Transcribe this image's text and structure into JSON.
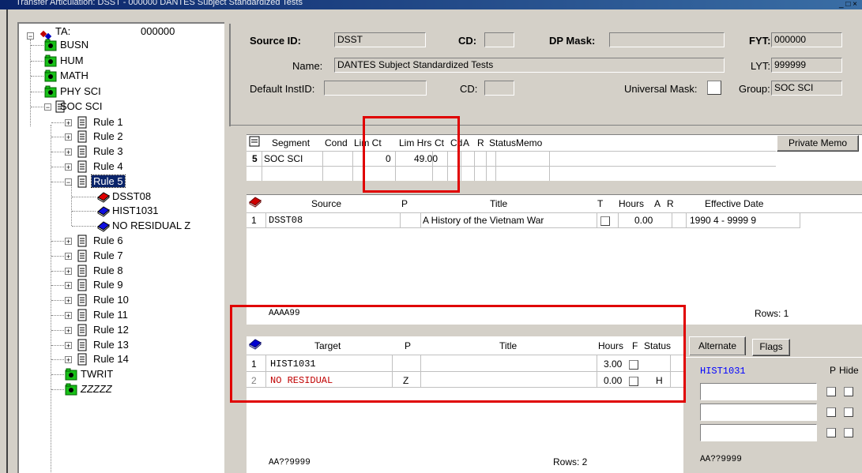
{
  "window": {
    "title": "Transfer Articulation: DSST - 000000 DANTES Subject Standardized Tests"
  },
  "tree": {
    "root": {
      "label": "TA:",
      "value": "000000"
    },
    "nodes": [
      {
        "label": "BUSN"
      },
      {
        "label": "HUM"
      },
      {
        "label": "MATH"
      },
      {
        "label": "PHY SCI"
      },
      {
        "label": "SOC SCI"
      }
    ],
    "rules_a": [
      {
        "label": "Rule 1"
      },
      {
        "label": "Rule 2"
      },
      {
        "label": "Rule 3"
      },
      {
        "label": "Rule 4"
      }
    ],
    "rule5": {
      "label": "Rule 5",
      "children": [
        {
          "label": "DSST08"
        },
        {
          "label": "HIST1031"
        },
        {
          "label": "NO RESIDUAL Z"
        }
      ]
    },
    "rules_b": [
      {
        "label": "Rule 6"
      },
      {
        "label": "Rule 7"
      },
      {
        "label": "Rule 8"
      },
      {
        "label": "Rule 9"
      },
      {
        "label": "Rule 10"
      },
      {
        "label": "Rule 11"
      },
      {
        "label": "Rule 12"
      },
      {
        "label": "Rule 13"
      },
      {
        "label": "Rule 14"
      }
    ],
    "bottom": [
      {
        "label": "TWRIT"
      },
      {
        "label": "ZZZZZ"
      }
    ]
  },
  "header": {
    "source_id_label": "Source ID:",
    "source_id": "DSST",
    "cd_label": "CD:",
    "cd": "",
    "dp_mask_label": "DP Mask:",
    "dp_mask": "",
    "fyt_label": "FYT:",
    "fyt": "000000",
    "name_label": "Name:",
    "name": "DANTES Subject Standardized Tests",
    "lyt_label": "LYT:",
    "lyt": "999999",
    "default_instid_label": "Default InstID:",
    "default_instid": "",
    "cd2_label": "CD:",
    "cd2": "",
    "universal_mask_label": "Universal Mask:",
    "group_label": "Group:",
    "group": "SOC SCI"
  },
  "segment": {
    "headers": [
      "Segment",
      "Cond",
      "Lim Ct",
      "Lim Hrs",
      "Ct",
      "Cd",
      "A",
      "R",
      "Status",
      "Memo"
    ],
    "private_memo": "Private Memo",
    "row": {
      "num": "5",
      "segment": "SOC SCI",
      "cond": "",
      "lim_ct": "0",
      "lim_hrs": "49.00"
    }
  },
  "source": {
    "headers": [
      "Source",
      "P",
      "Title",
      "T",
      "Hours",
      "A",
      "R",
      "Effective Date"
    ],
    "rows": [
      {
        "num": "1",
        "source": "DSST08",
        "p": "",
        "title": "A History of the Vietnam War",
        "hours": "0.00",
        "effective": "1990 4  - 9999 9"
      }
    ],
    "mask": "AAAA99",
    "rows_label": "Rows: 1"
  },
  "target": {
    "headers": [
      "Target",
      "P",
      "Title",
      "Hours",
      "F",
      "Status"
    ],
    "rows": [
      {
        "num": "1",
        "target": "HIST1031",
        "p": "",
        "title": "",
        "hours": "3.00",
        "status": ""
      },
      {
        "num": "2",
        "target": "NO RESIDUAL",
        "p": "Z",
        "title": "",
        "hours": "0.00",
        "status": "H"
      }
    ],
    "mask": "AA??9999",
    "rows_label": "Rows: 2"
  },
  "alternate": {
    "tabs": [
      "Alternate",
      "Flags"
    ],
    "course": "HIST1031",
    "p_label": "P",
    "hide_label": "Hide",
    "mask": "AA??9999"
  },
  "colors": {
    "selection": "#0a246a",
    "highlight_box": "#e00000",
    "blue_text": "#0000ff",
    "red_text": "#c00000"
  }
}
